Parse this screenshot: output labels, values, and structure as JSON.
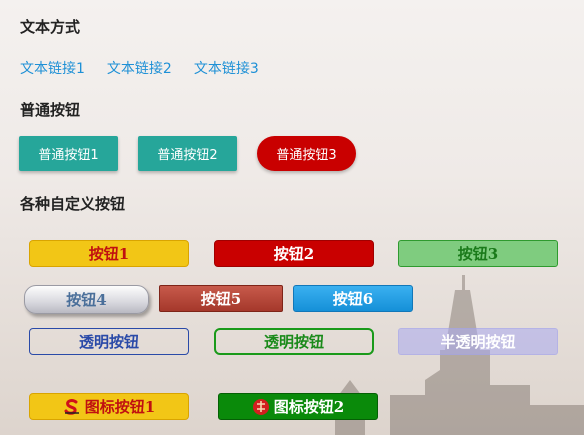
{
  "sections": {
    "text_style": "文本方式",
    "normal_buttons": "普通按钮",
    "custom_buttons": "各种自定义按钮"
  },
  "links": [
    "文本链接1",
    "文本链接2",
    "文本链接3"
  ],
  "normal_buttons": [
    "普通按钮1",
    "普通按钮2",
    "普通按钮3"
  ],
  "custom_buttons": {
    "btn1": "按钮1",
    "btn2": "按钮2",
    "btn3": "按钮3",
    "btn4": "按钮4",
    "btn5": "按钮5",
    "btn6": "按钮6",
    "transparent": "透明按钮",
    "transparent2": "透明按钮",
    "semi_transparent": "半透明按钮",
    "icon1": "图标按钮1",
    "icon2": "图标按钮2"
  },
  "icons": {
    "icon1": "sogou-icon",
    "icon2": "red-badge-icon"
  },
  "colors": {
    "link": "#1e90d6",
    "teal": "#26a69a",
    "red": "#c90000",
    "yellow": "#f2c616",
    "green": "#0a8a0a"
  }
}
